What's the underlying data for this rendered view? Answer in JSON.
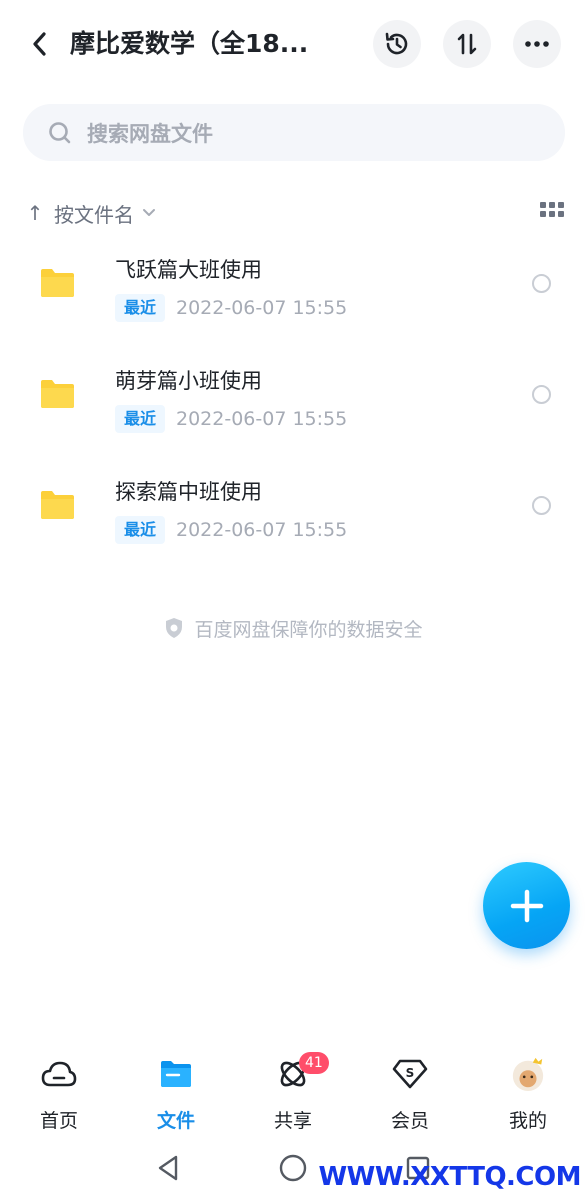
{
  "header": {
    "title": "摩比爱数学（全18...",
    "back_icon": "chevron-left-icon",
    "history_icon": "history-clock-icon",
    "transfer_icon": "transfer-arrows-icon",
    "more_icon": "more-dots-icon"
  },
  "search": {
    "placeholder": "搜索网盘文件",
    "icon": "search-icon"
  },
  "sort": {
    "arrow": "↑",
    "label": "按文件名",
    "view_icon": "grid-view-icon"
  },
  "files": [
    {
      "name": "飞跃篇大班使用",
      "badge": "最近",
      "date": "2022-06-07  15:55",
      "icon": "folder-icon"
    },
    {
      "name": "萌芽篇小班使用",
      "badge": "最近",
      "date": "2022-06-07  15:55",
      "icon": "folder-icon"
    },
    {
      "name": "探索篇中班使用",
      "badge": "最近",
      "date": "2022-06-07  15:55",
      "icon": "folder-icon"
    }
  ],
  "safety_note": "百度网盘保障你的数据安全",
  "fab": {
    "icon": "plus-icon"
  },
  "bottom_nav": [
    {
      "label": "首页",
      "icon": "cloud-icon",
      "active": false
    },
    {
      "label": "文件",
      "icon": "folder-icon",
      "active": true
    },
    {
      "label": "共享",
      "icon": "share-orbit-icon",
      "active": false,
      "badge": "41"
    },
    {
      "label": "会员",
      "icon": "vip-diamond-icon",
      "active": false
    },
    {
      "label": "我的",
      "icon": "avatar",
      "active": false
    }
  ],
  "system_nav": {
    "back_icon": "triangle-back-icon",
    "home_icon": "circle-home-icon",
    "recent_icon": "square-recent-icon"
  },
  "watermark": "WWW.XXTTQ.COM",
  "colors": {
    "accent": "#1a8ee8",
    "fab": "#06a5f5",
    "folder": "#fcd03a",
    "badge_red": "#ff4d6a"
  }
}
